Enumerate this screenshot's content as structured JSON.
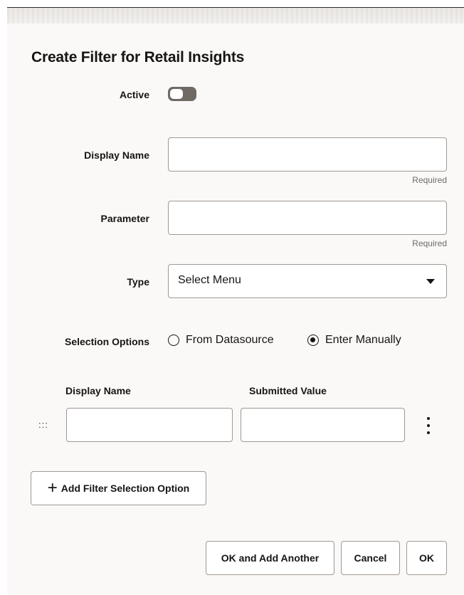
{
  "dialog": {
    "title": "Create Filter for Retail Insights",
    "active_label": "Active",
    "display_name_label": "Display Name",
    "display_name_value": "",
    "display_name_helper": "Required",
    "parameter_label": "Parameter",
    "parameter_value": "",
    "parameter_helper": "Required",
    "type_label": "Type",
    "type_value": "Select Menu",
    "selection_options_label": "Selection Options",
    "radio_datasource": "From Datasource",
    "radio_manual": "Enter Manually",
    "selected_option": "Enter Manually",
    "active": false
  },
  "options_table": {
    "col_display_name": "Display Name",
    "col_submitted_value": "Submitted Value",
    "drag_handle": ":::",
    "rows": [
      {
        "display_name": "",
        "submitted_value": ""
      }
    ]
  },
  "buttons": {
    "add_option": "Add Filter Selection Option",
    "ok_add_another": "OK and Add Another",
    "cancel": "Cancel",
    "ok": "OK"
  },
  "icons": {
    "toggle": "toggle-switch-icon",
    "caret": "caret-down-icon",
    "drag": "drag-handle-icon",
    "more": "more-vertical-icon",
    "plus": "plus-icon"
  },
  "colors": {
    "dialog_bg": "#fbf9f8",
    "border": "#9e9892",
    "toggle_off": "#6f6a64",
    "text": "#161513"
  }
}
